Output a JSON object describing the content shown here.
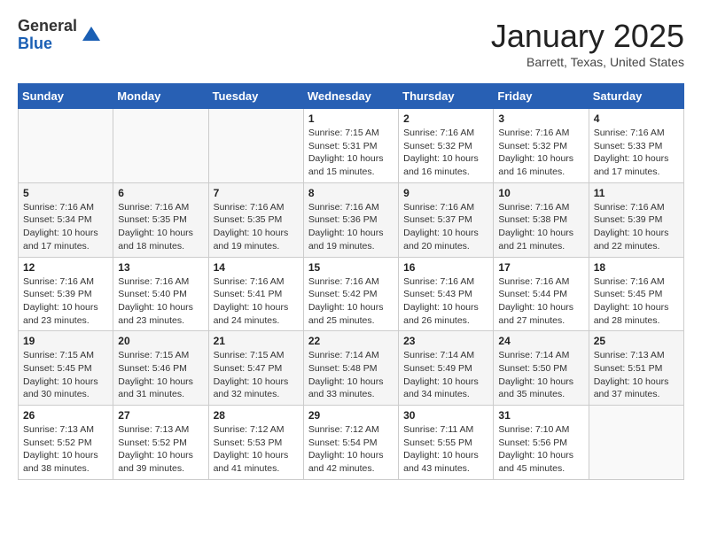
{
  "logo": {
    "general": "General",
    "blue": "Blue"
  },
  "title": "January 2025",
  "subtitle": "Barrett, Texas, United States",
  "days_of_week": [
    "Sunday",
    "Monday",
    "Tuesday",
    "Wednesday",
    "Thursday",
    "Friday",
    "Saturday"
  ],
  "weeks": [
    [
      {
        "day": "",
        "info": ""
      },
      {
        "day": "",
        "info": ""
      },
      {
        "day": "",
        "info": ""
      },
      {
        "day": "1",
        "info": "Sunrise: 7:15 AM\nSunset: 5:31 PM\nDaylight: 10 hours\nand 15 minutes."
      },
      {
        "day": "2",
        "info": "Sunrise: 7:16 AM\nSunset: 5:32 PM\nDaylight: 10 hours\nand 16 minutes."
      },
      {
        "day": "3",
        "info": "Sunrise: 7:16 AM\nSunset: 5:32 PM\nDaylight: 10 hours\nand 16 minutes."
      },
      {
        "day": "4",
        "info": "Sunrise: 7:16 AM\nSunset: 5:33 PM\nDaylight: 10 hours\nand 17 minutes."
      }
    ],
    [
      {
        "day": "5",
        "info": "Sunrise: 7:16 AM\nSunset: 5:34 PM\nDaylight: 10 hours\nand 17 minutes."
      },
      {
        "day": "6",
        "info": "Sunrise: 7:16 AM\nSunset: 5:35 PM\nDaylight: 10 hours\nand 18 minutes."
      },
      {
        "day": "7",
        "info": "Sunrise: 7:16 AM\nSunset: 5:35 PM\nDaylight: 10 hours\nand 19 minutes."
      },
      {
        "day": "8",
        "info": "Sunrise: 7:16 AM\nSunset: 5:36 PM\nDaylight: 10 hours\nand 19 minutes."
      },
      {
        "day": "9",
        "info": "Sunrise: 7:16 AM\nSunset: 5:37 PM\nDaylight: 10 hours\nand 20 minutes."
      },
      {
        "day": "10",
        "info": "Sunrise: 7:16 AM\nSunset: 5:38 PM\nDaylight: 10 hours\nand 21 minutes."
      },
      {
        "day": "11",
        "info": "Sunrise: 7:16 AM\nSunset: 5:39 PM\nDaylight: 10 hours\nand 22 minutes."
      }
    ],
    [
      {
        "day": "12",
        "info": "Sunrise: 7:16 AM\nSunset: 5:39 PM\nDaylight: 10 hours\nand 23 minutes."
      },
      {
        "day": "13",
        "info": "Sunrise: 7:16 AM\nSunset: 5:40 PM\nDaylight: 10 hours\nand 23 minutes."
      },
      {
        "day": "14",
        "info": "Sunrise: 7:16 AM\nSunset: 5:41 PM\nDaylight: 10 hours\nand 24 minutes."
      },
      {
        "day": "15",
        "info": "Sunrise: 7:16 AM\nSunset: 5:42 PM\nDaylight: 10 hours\nand 25 minutes."
      },
      {
        "day": "16",
        "info": "Sunrise: 7:16 AM\nSunset: 5:43 PM\nDaylight: 10 hours\nand 26 minutes."
      },
      {
        "day": "17",
        "info": "Sunrise: 7:16 AM\nSunset: 5:44 PM\nDaylight: 10 hours\nand 27 minutes."
      },
      {
        "day": "18",
        "info": "Sunrise: 7:16 AM\nSunset: 5:45 PM\nDaylight: 10 hours\nand 28 minutes."
      }
    ],
    [
      {
        "day": "19",
        "info": "Sunrise: 7:15 AM\nSunset: 5:45 PM\nDaylight: 10 hours\nand 30 minutes."
      },
      {
        "day": "20",
        "info": "Sunrise: 7:15 AM\nSunset: 5:46 PM\nDaylight: 10 hours\nand 31 minutes."
      },
      {
        "day": "21",
        "info": "Sunrise: 7:15 AM\nSunset: 5:47 PM\nDaylight: 10 hours\nand 32 minutes."
      },
      {
        "day": "22",
        "info": "Sunrise: 7:14 AM\nSunset: 5:48 PM\nDaylight: 10 hours\nand 33 minutes."
      },
      {
        "day": "23",
        "info": "Sunrise: 7:14 AM\nSunset: 5:49 PM\nDaylight: 10 hours\nand 34 minutes."
      },
      {
        "day": "24",
        "info": "Sunrise: 7:14 AM\nSunset: 5:50 PM\nDaylight: 10 hours\nand 35 minutes."
      },
      {
        "day": "25",
        "info": "Sunrise: 7:13 AM\nSunset: 5:51 PM\nDaylight: 10 hours\nand 37 minutes."
      }
    ],
    [
      {
        "day": "26",
        "info": "Sunrise: 7:13 AM\nSunset: 5:52 PM\nDaylight: 10 hours\nand 38 minutes."
      },
      {
        "day": "27",
        "info": "Sunrise: 7:13 AM\nSunset: 5:52 PM\nDaylight: 10 hours\nand 39 minutes."
      },
      {
        "day": "28",
        "info": "Sunrise: 7:12 AM\nSunset: 5:53 PM\nDaylight: 10 hours\nand 41 minutes."
      },
      {
        "day": "29",
        "info": "Sunrise: 7:12 AM\nSunset: 5:54 PM\nDaylight: 10 hours\nand 42 minutes."
      },
      {
        "day": "30",
        "info": "Sunrise: 7:11 AM\nSunset: 5:55 PM\nDaylight: 10 hours\nand 43 minutes."
      },
      {
        "day": "31",
        "info": "Sunrise: 7:10 AM\nSunset: 5:56 PM\nDaylight: 10 hours\nand 45 minutes."
      },
      {
        "day": "",
        "info": ""
      }
    ]
  ]
}
